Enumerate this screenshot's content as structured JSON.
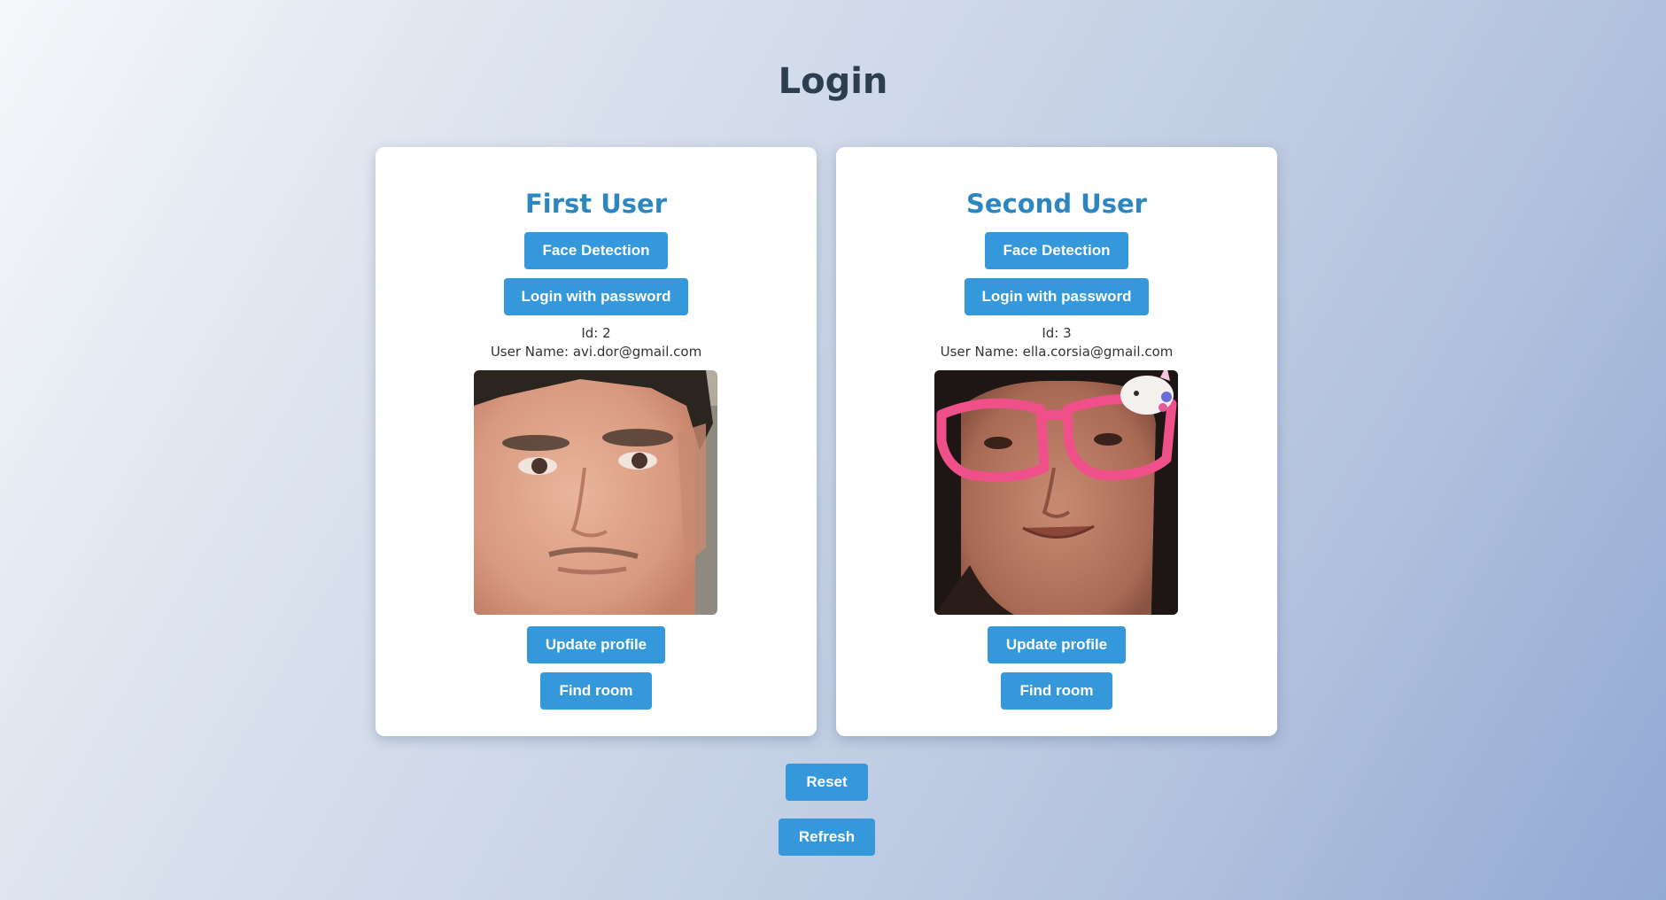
{
  "page": {
    "title": "Login"
  },
  "users": [
    {
      "heading": "First User",
      "face_detection_label": "Face Detection",
      "login_password_label": "Login with password",
      "id_text": "Id: 2",
      "username_text": "User Name: avi.dor@gmail.com",
      "update_profile_label": "Update profile",
      "find_room_label": "Find room"
    },
    {
      "heading": "Second User",
      "face_detection_label": "Face Detection",
      "login_password_label": "Login with password",
      "id_text": "Id: 3",
      "username_text": "User Name: ella.corsia@gmail.com",
      "update_profile_label": "Update profile",
      "find_room_label": "Find room"
    }
  ],
  "actions": {
    "reset_label": "Reset",
    "refresh_label": "Refresh"
  },
  "colors": {
    "accent": "#3498db",
    "heading": "#2e86c1",
    "title": "#2c3e50"
  }
}
